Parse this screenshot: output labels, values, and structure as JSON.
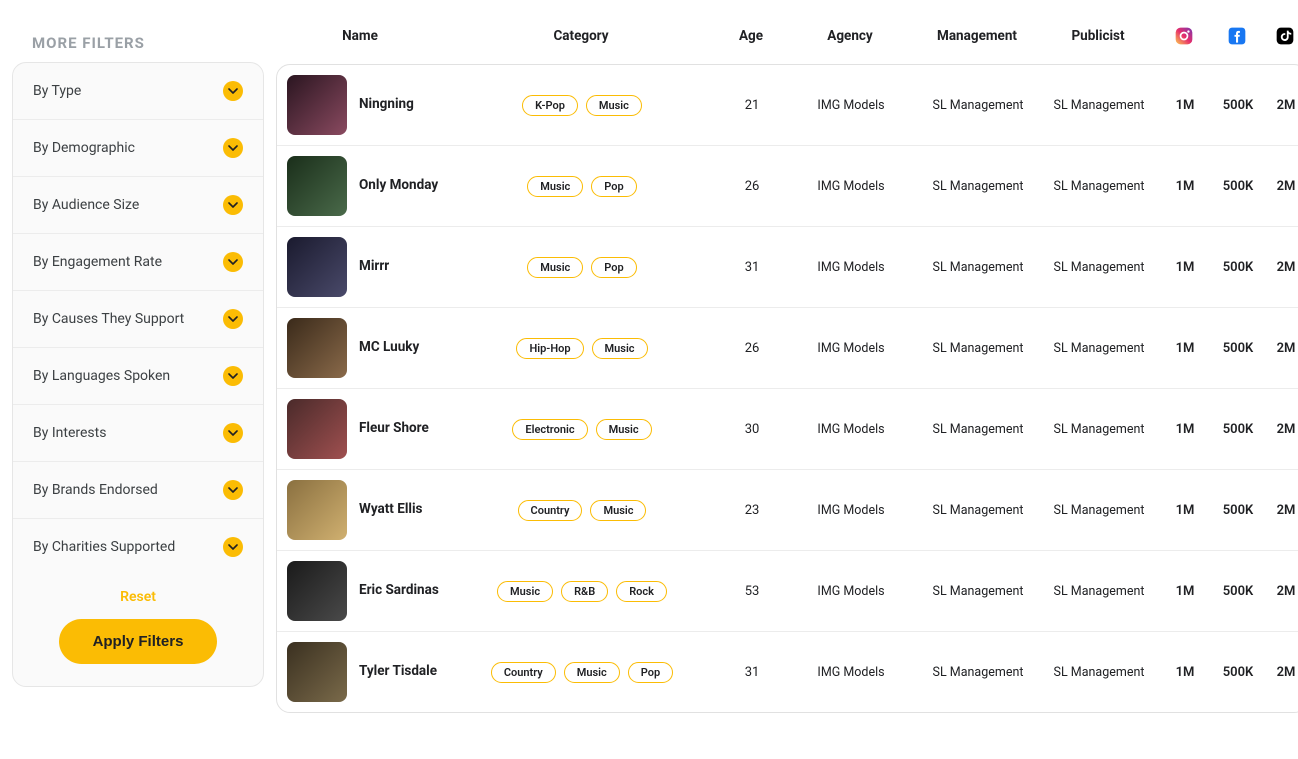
{
  "sidebar": {
    "title": "MORE FILTERS",
    "items": [
      "By Type",
      "By Demographic",
      "By Audience Size",
      "By Engagement Rate",
      "By Causes They Support",
      "By Languages Spoken",
      "By Interests",
      "By Brands Endorsed",
      "By Charities Supported"
    ],
    "reset_label": "Reset",
    "apply_label": "Apply Filters"
  },
  "columns": {
    "name": "Name",
    "category": "Category",
    "age": "Age",
    "agency": "Agency",
    "management": "Management",
    "publicist": "Publicist",
    "instagram": "Instagram",
    "facebook": "Facebook",
    "tiktok": "TikTok"
  },
  "rows": [
    {
      "name": "Ningning",
      "categories": [
        "K-Pop",
        "Music"
      ],
      "age": "21",
      "agency": "IMG Models",
      "management": "SL  Management",
      "publicist": "SL  Management",
      "instagram": "1M",
      "facebook": "500K",
      "tiktok": "2M"
    },
    {
      "name": "Only Monday",
      "categories": [
        "Music",
        "Pop"
      ],
      "age": "26",
      "agency": "IMG Models",
      "management": "SL  Management",
      "publicist": "SL  Management",
      "instagram": "1M",
      "facebook": "500K",
      "tiktok": "2M"
    },
    {
      "name": "Mirrr",
      "categories": [
        "Music",
        "Pop"
      ],
      "age": "31",
      "agency": "IMG Models",
      "management": "SL  Management",
      "publicist": "SL  Management",
      "instagram": "1M",
      "facebook": "500K",
      "tiktok": "2M"
    },
    {
      "name": "MC Luuky",
      "categories": [
        "Hip-Hop",
        "Music"
      ],
      "age": "26",
      "agency": "IMG Models",
      "management": "SL  Management",
      "publicist": "SL  Management",
      "instagram": "1M",
      "facebook": "500K",
      "tiktok": "2M"
    },
    {
      "name": "Fleur Shore",
      "categories": [
        "Electronic",
        "Music"
      ],
      "age": "30",
      "agency": "IMG Models",
      "management": "SL  Management",
      "publicist": "SL  Management",
      "instagram": "1M",
      "facebook": "500K",
      "tiktok": "2M"
    },
    {
      "name": "Wyatt Ellis",
      "categories": [
        "Country",
        "Music"
      ],
      "age": "23",
      "agency": "IMG Models",
      "management": "SL  Management",
      "publicist": "SL  Management",
      "instagram": "1M",
      "facebook": "500K",
      "tiktok": "2M"
    },
    {
      "name": "Eric Sardinas",
      "categories": [
        "Music",
        "R&B",
        "Rock"
      ],
      "age": "53",
      "agency": "IMG Models",
      "management": "SL  Management",
      "publicist": "SL  Management",
      "instagram": "1M",
      "facebook": "500K",
      "tiktok": "2M"
    },
    {
      "name": "Tyler Tisdale",
      "categories": [
        "Country",
        "Music",
        "Pop"
      ],
      "age": "31",
      "agency": "IMG Models",
      "management": "SL  Management",
      "publicist": "SL  Management",
      "instagram": "1M",
      "facebook": "500K",
      "tiktok": "2M"
    }
  ]
}
